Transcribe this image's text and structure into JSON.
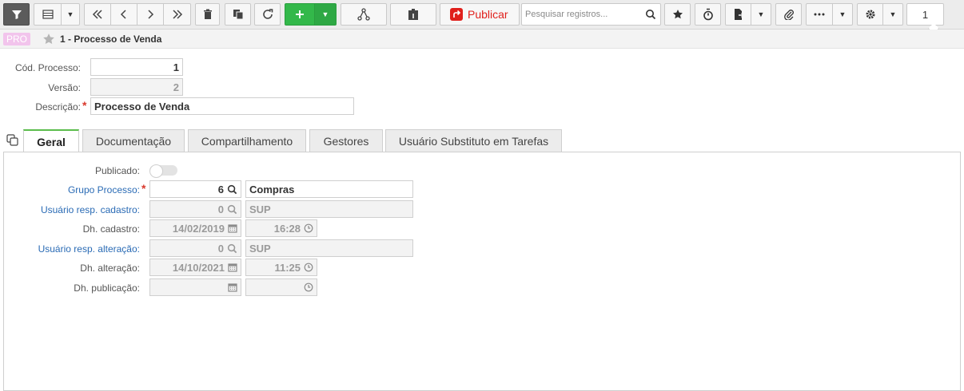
{
  "toolbar": {
    "publish_label": "Publicar",
    "search_placeholder": "Pesquisar registros...",
    "page_number": "1",
    "icons": [
      "filter-icon",
      "list-icon",
      "chevron-down-icon",
      "first-icon",
      "prev-icon",
      "next-icon",
      "last-icon",
      "trash-icon",
      "copy-icon",
      "refresh-icon",
      "plus-icon",
      "workflow-icon",
      "info-card-icon",
      "publish-icon",
      "search-icon",
      "star-icon",
      "stopwatch-icon",
      "export-icon",
      "paperclip-icon",
      "more-icon",
      "gear-icon"
    ],
    "colors": {
      "accent_green": "#33b84a",
      "publish_red": "#e0201c"
    }
  },
  "breadcrumb": {
    "badge": "PRO",
    "title": "1 - Processo de Venda"
  },
  "header_form": {
    "cod_label": "Cód. Processo:",
    "cod_value": "1",
    "versao_label": "Versão:",
    "versao_value": "2",
    "descricao_label": "Descrição:",
    "descricao_value": "Processo de Venda"
  },
  "tabs": [
    {
      "label": "Geral"
    },
    {
      "label": "Documentação"
    },
    {
      "label": "Compartilhamento"
    },
    {
      "label": "Gestores"
    },
    {
      "label": "Usuário Substituto em Tarefas"
    }
  ],
  "geral": {
    "publicado_label": "Publicado:",
    "grupo_label": "Grupo Processo:",
    "grupo_code": "6",
    "grupo_name": "Compras",
    "usr_cad_label": "Usuário resp. cadastro:",
    "usr_cad_code": "0",
    "usr_cad_name": "SUP",
    "dh_cad_label": "Dh. cadastro:",
    "dh_cad_date": "14/02/2019",
    "dh_cad_time": "16:28",
    "usr_alt_label": "Usuário resp. alteração:",
    "usr_alt_code": "0",
    "usr_alt_name": "SUP",
    "dh_alt_label": "Dh. alteração:",
    "dh_alt_date": "14/10/2021",
    "dh_alt_time": "11:25",
    "dh_pub_label": "Dh. publicação:",
    "dh_pub_date": "",
    "dh_pub_time": ""
  }
}
